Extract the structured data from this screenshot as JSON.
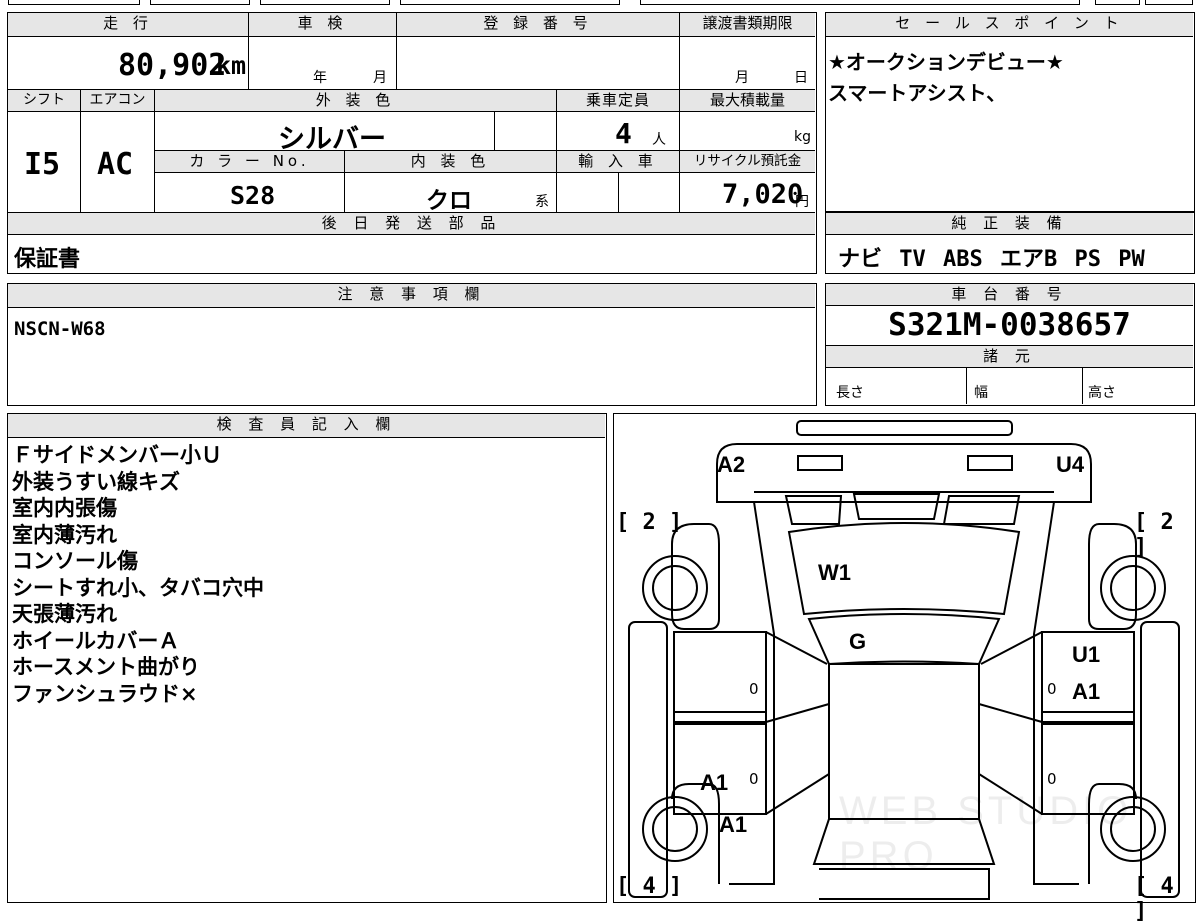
{
  "vehicle": {
    "mileage": {
      "header": "走 行",
      "value": "80,902",
      "unit": "km"
    },
    "inspection": {
      "header": "車 検",
      "year_label": "年",
      "month_label": "月"
    },
    "registration_number": {
      "header": "登 録 番 号"
    },
    "transfer_deadline": {
      "header": "譲渡書類期限",
      "month_label": "月",
      "day_label": "日"
    },
    "shift": {
      "header": "シフト",
      "value": "I5"
    },
    "aircon": {
      "header": "エアコン",
      "value": "AC"
    },
    "exterior_color": {
      "header": "外 装 色",
      "value": "シルバー"
    },
    "capacity": {
      "header": "乗車定員",
      "value": "4",
      "unit": "人"
    },
    "max_load": {
      "header": "最大積載量",
      "unit": "kg"
    },
    "color_no": {
      "header": "カ ラ ー No.",
      "value": "S28"
    },
    "interior_color": {
      "header": "内 装 色",
      "value": "クロ",
      "suffix": "系"
    },
    "import_car": {
      "header": "輸 入 車"
    },
    "recycle_fee": {
      "header": "リサイクル預託金",
      "value": "7,020",
      "unit": "円"
    },
    "later_parts": {
      "header": "後 日 発 送 部 品",
      "value": "保証書"
    }
  },
  "sales_point": {
    "header": "セ ー ル ス ポ イ ン ト",
    "lines": [
      "★オークションデビュー★",
      "スマートアシスト、"
    ]
  },
  "equipment": {
    "header": "純 正 装 備",
    "items": [
      "ナビ",
      "TV",
      "ABS",
      "エアB",
      "PS",
      "PW"
    ]
  },
  "notes": {
    "header": "注 意 事 項 欄",
    "value": "NSCN-W68"
  },
  "chassis": {
    "header": "車 台 番 号",
    "value": "S321M-0038657"
  },
  "specs": {
    "header": "諸 元",
    "length": "長さ",
    "width": "幅",
    "height": "高さ"
  },
  "inspector": {
    "header": "検 査 員 記 入 欄",
    "lines": [
      "Ｆサイドメンバー小Ｕ",
      "外装うすい線キズ",
      "室内内張傷",
      "室内薄汚れ",
      "コンソール傷",
      "シートすれ小、タバコ穴中",
      "天張薄汚れ",
      "ホイールカバーＡ",
      "ホースメント曲がり",
      "ファンシュラウド×"
    ]
  },
  "diagram": {
    "labels": {
      "front_left": "A2",
      "front_right": "U4",
      "windshield": "W1",
      "glass": "G",
      "right_door_1": "U1",
      "right_door_2": "A1",
      "left_rear_1": "A1",
      "left_rear_2": "A1"
    },
    "tire_front_left": "[ 2 ]",
    "tire_front_right": "[ 2 ]",
    "tire_rear_left": "[ 4 ]",
    "tire_rear_right": "[ 4 ]",
    "zero": "0",
    "watermark": "WEB STUDIO PRO"
  }
}
